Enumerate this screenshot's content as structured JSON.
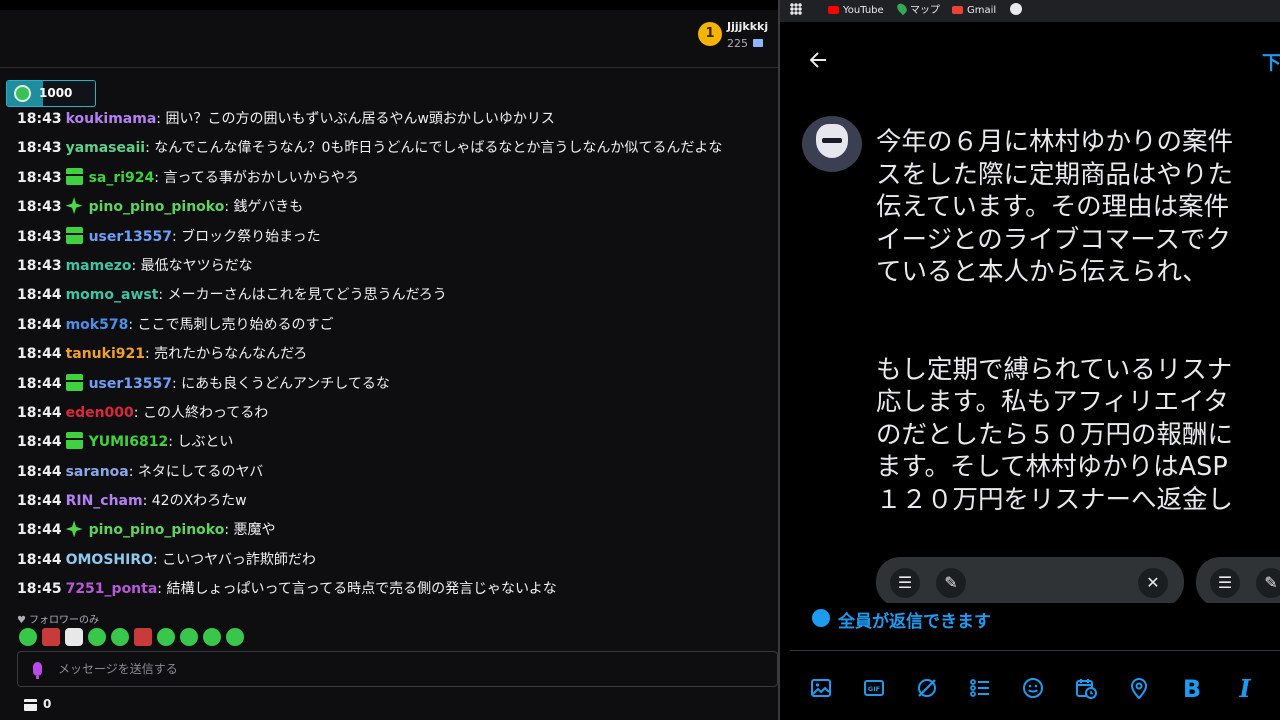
{
  "chat": {
    "rank_badge": "1",
    "rank_user": "Jjjjkkkj",
    "rank_points": "225",
    "goal_value": "1000",
    "messages": [
      {
        "time": "18:43",
        "badge": "",
        "user": "koukimama",
        "user_color": "#b57ff5",
        "text": ": 囲い？この方の囲いもずいぶん居るやんw頭おかしいゆかリス"
      },
      {
        "time": "18:43",
        "badge": "",
        "user": "yamaseaii",
        "user_color": "#5fd08a",
        "text": ": なんでこんな偉そうなん？0も昨日うどんにでしゃばるなとか言うしなんか似てるんだよな"
      },
      {
        "time": "18:43",
        "badge": "gift",
        "user": "sa_ri924",
        "user_color": "#3fd13f",
        "text": ": 言ってる事がおかしいからやろ"
      },
      {
        "time": "18:43",
        "badge": "star",
        "user": "pino_pino_pinoko",
        "user_color": "#5ed35e",
        "text": ": 銭ゲバきも"
      },
      {
        "time": "18:43",
        "badge": "gift",
        "user": "user13557",
        "user_color": "#6e9ef7",
        "text": ": ブロック祭り始まった"
      },
      {
        "time": "18:43",
        "badge": "",
        "user": "mamezo",
        "user_color": "#41c4a1",
        "text": ": 最低なヤツらだな"
      },
      {
        "time": "18:44",
        "badge": "",
        "user": "momo_awst",
        "user_color": "#41c4a1",
        "text": ": メーカーさんはこれを見てどう思うんだろう"
      },
      {
        "time": "18:44",
        "badge": "",
        "user": "mok578",
        "user_color": "#4f8ee8",
        "text": ": ここで馬刺し売り始めるのすご"
      },
      {
        "time": "18:44",
        "badge": "",
        "user": "tanuki921",
        "user_color": "#f0a02a",
        "text": ": 売れたからなんなんだろ"
      },
      {
        "time": "18:44",
        "badge": "gift",
        "user": "user13557",
        "user_color": "#6e9ef7",
        "text": ": にあも良くうどんアンチしてるな"
      },
      {
        "time": "18:44",
        "badge": "",
        "user": "eden000",
        "user_color": "#d9283a",
        "text": ": この人終わってるわ"
      },
      {
        "time": "18:44",
        "badge": "gift",
        "user": "YUMI6812",
        "user_color": "#3fd13f",
        "text": ": しぶとい"
      },
      {
        "time": "18:44",
        "badge": "",
        "user": "saranoa",
        "user_color": "#8aa6e8",
        "text": ": ネタにしてるのヤバ"
      },
      {
        "time": "18:44",
        "badge": "",
        "user": "RIN_cham",
        "user_color": "#b57ff5",
        "text": ": 42のXわろたw"
      },
      {
        "time": "18:44",
        "badge": "star",
        "user": "pino_pino_pinoko",
        "user_color": "#5ed35e",
        "text": ": 悪魔や"
      },
      {
        "time": "18:44",
        "badge": "",
        "user": "OMOSHIRO",
        "user_color": "#8fc9f0",
        "text": ": こいつヤバっ詐欺師だわ"
      },
      {
        "time": "18:45",
        "badge": "",
        "user": "7251_ponta",
        "user_color": "#b45ad8",
        "text": ": 結構しょっぱいって言ってる時点で売る側の発言じゃないよな"
      }
    ],
    "followers_only": "フォロワーのみ",
    "input_placeholder": "メッセージを送信する",
    "store_count": "0"
  },
  "browser": {
    "bookmarks": {
      "youtube": "YouTube",
      "maps": "マップ",
      "gmail": "Gmail"
    },
    "top_right": "下",
    "tweet_lines": [
      "今年の６月に林村ゆかりの案件",
      "スをした際に定期商品はやりた",
      "伝えています。その理由は案件",
      "イージとのライブコマースでク",
      "ていると本人から伝えられ、",
      "",
      "もし定期で縛られているリスナ",
      "応します。私もアフィリエイタ",
      "のだとしたら５０万円の報酬に",
      "ます。そして林村ゆかりはASP",
      "１２０万円をリスナーへ返金し"
    ],
    "reply_setting": "全員が返信できます",
    "toolbar_bold": "B",
    "toolbar_italic": "I"
  },
  "colors": {
    "accent_blue": "#1d9bf0",
    "chat_bg": "#0e0e10",
    "goal_border": "#27b0c9"
  }
}
